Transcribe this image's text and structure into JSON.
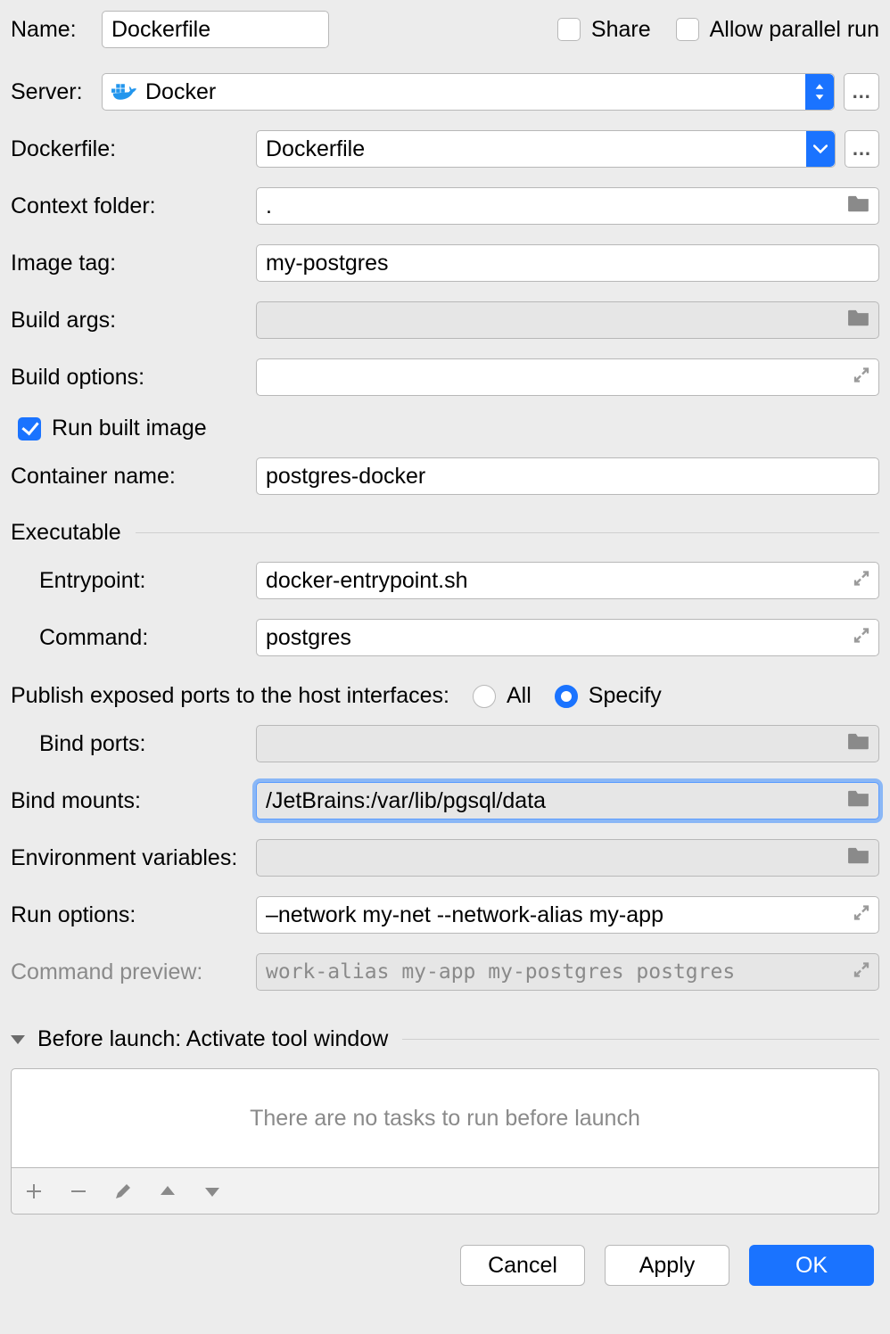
{
  "name": {
    "label": "Name:",
    "value": "Dockerfile"
  },
  "share": {
    "label": "Share",
    "checked": false
  },
  "allowParallel": {
    "label": "Allow parallel run",
    "checked": false
  },
  "server": {
    "label": "Server:",
    "value": "Docker"
  },
  "dockerfile": {
    "label": "Dockerfile:",
    "value": "Dockerfile"
  },
  "contextFolder": {
    "label": "Context folder:",
    "value": "."
  },
  "imageTag": {
    "label": "Image tag:",
    "value": "my-postgres"
  },
  "buildArgs": {
    "label": "Build args:",
    "value": ""
  },
  "buildOptions": {
    "label": "Build options:",
    "value": ""
  },
  "runBuilt": {
    "label": "Run built image",
    "checked": true
  },
  "containerName": {
    "label": "Container name:",
    "value": "postgres-docker"
  },
  "executable": {
    "title": "Executable",
    "entrypoint": {
      "label": "Entrypoint:",
      "value": "docker-entrypoint.sh"
    },
    "command": {
      "label": "Command:",
      "value": "postgres"
    }
  },
  "publishPorts": {
    "label": "Publish exposed ports to the host interfaces:",
    "options": {
      "all": "All",
      "specify": "Specify"
    },
    "selected": "specify"
  },
  "bindPorts": {
    "label": "Bind ports:",
    "value": ""
  },
  "bindMounts": {
    "label": "Bind mounts:",
    "value": "/JetBrains:/var/lib/pgsql/data"
  },
  "envVars": {
    "label": "Environment variables:",
    "value": ""
  },
  "runOptions": {
    "label": "Run options:",
    "value": "–network my-net --network-alias my-app"
  },
  "commandPreview": {
    "label": "Command preview:",
    "value": "work-alias my-app my-postgres postgres"
  },
  "beforeLaunch": {
    "title": "Before launch: Activate tool window",
    "empty": "There are no tasks to run before launch"
  },
  "buttons": {
    "cancel": "Cancel",
    "apply": "Apply",
    "ok": "OK"
  }
}
